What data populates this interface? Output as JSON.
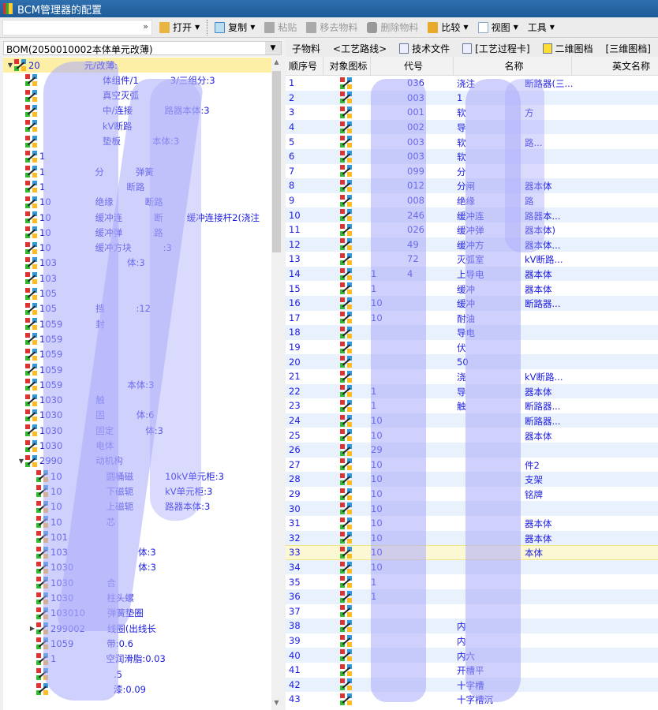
{
  "window": {
    "title": "BCM管理器的配置"
  },
  "toolbar": {
    "quick_dropdown": "»",
    "open": "打开",
    "copy": "复制",
    "paste": "粘贴",
    "move": "移去物料",
    "delete": "删除物料",
    "compare": "比较",
    "view": "视图",
    "tools": "工具"
  },
  "left": {
    "bom_select": "BOM(2050010002本体单元改薄)",
    "tree": [
      {
        "lvl": 0,
        "tw": "▼",
        "code": "20",
        "name": "元/改薄:"
      },
      {
        "lvl": 1,
        "code": "",
        "name": "体组件/1",
        "tail": "3/三组分:3"
      },
      {
        "lvl": 1,
        "code": "",
        "name": "真空灭弧"
      },
      {
        "lvl": 1,
        "code": "",
        "name": "中/连接",
        "tail": "路器本体:3"
      },
      {
        "lvl": 1,
        "code": "",
        "name": "kV断路"
      },
      {
        "lvl": 1,
        "code": "",
        "name": "垫板",
        "tail": "本体:3"
      },
      {
        "lvl": 1,
        "code": "1",
        "name": ""
      },
      {
        "lvl": 1,
        "code": "1",
        "name": "分",
        "tail": "弹簧"
      },
      {
        "lvl": 1,
        "code": "1",
        "name": "",
        "tail": "断路"
      },
      {
        "lvl": 1,
        "code": "10",
        "name": "绝缘",
        "tail": "断路"
      },
      {
        "lvl": 1,
        "code": "10",
        "name": "缓冲连",
        "tail": "断",
        "tail2": "缓冲连接杆2(浇注"
      },
      {
        "lvl": 1,
        "code": "10",
        "name": "缓冲弹",
        "tail": "路"
      },
      {
        "lvl": 1,
        "code": "10",
        "name": "缓冲方块",
        "tail": ":3"
      },
      {
        "lvl": 1,
        "code": "103",
        "name": "",
        "tail": "体:3"
      },
      {
        "lvl": 1,
        "code": "103",
        "name": ""
      },
      {
        "lvl": 1,
        "code": "105",
        "name": ""
      },
      {
        "lvl": 1,
        "code": "105",
        "name": "挡",
        "tail": ":12"
      },
      {
        "lvl": 1,
        "code": "1059",
        "name": "封"
      },
      {
        "lvl": 1,
        "code": "1059",
        "name": ""
      },
      {
        "lvl": 1,
        "code": "1059",
        "name": ""
      },
      {
        "lvl": 1,
        "code": "1059",
        "name": ""
      },
      {
        "lvl": 1,
        "code": "1059",
        "name": "",
        "tail": "本体:3"
      },
      {
        "lvl": 1,
        "code": "1030",
        "name": "触"
      },
      {
        "lvl": 1,
        "code": "1030",
        "name": "固",
        "tail": "体:6"
      },
      {
        "lvl": 1,
        "code": "1030",
        "name": "固定",
        "tail": "体:3"
      },
      {
        "lvl": 1,
        "code": "1030",
        "name": "电体"
      },
      {
        "lvl": 1,
        "tw": "▼",
        "code": "2990",
        "name": "动机构"
      },
      {
        "lvl": 2,
        "code": "10",
        "name": "圆桶磁",
        "tail": "10kV单元柜:3"
      },
      {
        "lvl": 2,
        "code": "10",
        "name": "下磁轭",
        "tail": "kV单元柜:3"
      },
      {
        "lvl": 2,
        "code": "10",
        "name": "上磁轭",
        "tail": "路器本体:3"
      },
      {
        "lvl": 2,
        "code": "10",
        "name": "芯"
      },
      {
        "lvl": 2,
        "code": "101",
        "name": ""
      },
      {
        "lvl": 2,
        "code": "103",
        "name": "",
        "tail": "体:3"
      },
      {
        "lvl": 2,
        "code": "1030",
        "name": "",
        "tail": "体:3"
      },
      {
        "lvl": 2,
        "code": "1030",
        "name": "合"
      },
      {
        "lvl": 2,
        "code": "1030",
        "name": "柱头螺"
      },
      {
        "lvl": 2,
        "code": "103010",
        "name": "弹簧垫圈"
      },
      {
        "lvl": 2,
        "tw": "▶",
        "code": "299002",
        "name": "线圈(出线长"
      },
      {
        "lvl": 2,
        "code": "1059",
        "name": "带:0.6"
      },
      {
        "lvl": 2,
        "code": "1",
        "name": "空润滑脂:0.03"
      },
      {
        "lvl": 2,
        "code": "",
        "name": ".5"
      },
      {
        "lvl": 2,
        "code": "",
        "name": "漆:0.09"
      }
    ]
  },
  "right": {
    "tabs": [
      {
        "label": "子物料",
        "icon": ""
      },
      {
        "label": "<工艺路线>",
        "icon": ""
      },
      {
        "label": "技术文件",
        "icon": "document-icon"
      },
      {
        "label": "[工艺过程卡]",
        "icon": "process-card-icon"
      },
      {
        "label": "二维图档",
        "icon": "drawing-2d-icon"
      },
      {
        "label": "[三维图档]",
        "icon": ""
      }
    ],
    "columns": [
      "顺序号",
      "对象图标",
      "代号",
      "名称",
      "英文名称"
    ],
    "selected_row": 33,
    "rows": [
      {
        "seq": "1",
        "code": "",
        "code2": "036",
        "name": "浇注",
        "name2": "断路器(三..."
      },
      {
        "seq": "2",
        "code": "",
        "code2": "003",
        "name": "1",
        "name2": ""
      },
      {
        "seq": "3",
        "code": "",
        "code2": "001",
        "name": "软",
        "name2": "方"
      },
      {
        "seq": "4",
        "code": "",
        "code2": "002",
        "name": "导",
        "name2": ""
      },
      {
        "seq": "5",
        "code": "",
        "code2": "003",
        "name": "软",
        "name2": "路..."
      },
      {
        "seq": "6",
        "code": "",
        "code2": "003",
        "name": "软",
        "name2": ""
      },
      {
        "seq": "7",
        "code": "",
        "code2": "099",
        "name": "分",
        "name2": ""
      },
      {
        "seq": "8",
        "code": "",
        "code2": "012",
        "name": "分闸",
        "name2": "器本体"
      },
      {
        "seq": "9",
        "code": "",
        "code2": "008",
        "name": "绝缘",
        "name2": "路"
      },
      {
        "seq": "10",
        "code": "",
        "code2": "246",
        "name": "缓冲连",
        "name2": "路器本..."
      },
      {
        "seq": "11",
        "code": "",
        "code2": "026",
        "name": "缓冲弹",
        "name2": "器本体)"
      },
      {
        "seq": "12",
        "code": "",
        "code2": "49",
        "name": "缓冲方",
        "name2": "器本体..."
      },
      {
        "seq": "13",
        "code": "",
        "code2": "72",
        "name": "灭弧室",
        "name2": "kV断路..."
      },
      {
        "seq": "14",
        "code": "1",
        "code2": "4",
        "name": "上导电",
        "name2": "器本体"
      },
      {
        "seq": "15",
        "code": "1",
        "code2": "",
        "name": "缓冲",
        "name2": "器本体"
      },
      {
        "seq": "16",
        "code": "10",
        "code2": "",
        "name": "缓冲",
        "name2": "断路器..."
      },
      {
        "seq": "17",
        "code": "10",
        "code2": "",
        "name": "耐油",
        "name2": ""
      },
      {
        "seq": "18",
        "code": "",
        "code2": "",
        "name": "导电",
        "name2": ""
      },
      {
        "seq": "19",
        "code": "",
        "code2": "",
        "name": "伏",
        "name2": ""
      },
      {
        "seq": "20",
        "code": "",
        "code2": "",
        "name": "50",
        "name2": ""
      },
      {
        "seq": "21",
        "code": "",
        "code2": "",
        "name": "浇",
        "name2": "kV断路..."
      },
      {
        "seq": "22",
        "code": "1",
        "code2": "",
        "name": "导",
        "name2": "器本体"
      },
      {
        "seq": "23",
        "code": "1",
        "code2": "",
        "name": "触",
        "name2": "断路器..."
      },
      {
        "seq": "24",
        "code": "10",
        "code2": "",
        "name": "",
        "name2": "断路器..."
      },
      {
        "seq": "25",
        "code": "10",
        "code2": "",
        "name": "",
        "name2": "器本体"
      },
      {
        "seq": "26",
        "code": "29",
        "code2": "",
        "name": "",
        "name2": ""
      },
      {
        "seq": "27",
        "code": "10",
        "code2": "",
        "name": "",
        "name2": "件2"
      },
      {
        "seq": "28",
        "code": "10",
        "code2": "",
        "name": "",
        "name2": "支架"
      },
      {
        "seq": "29",
        "code": "10",
        "code2": "",
        "name": "",
        "name2": "铭牌"
      },
      {
        "seq": "30",
        "code": "10",
        "code2": "",
        "name": "",
        "name2": ""
      },
      {
        "seq": "31",
        "code": "10",
        "code2": "",
        "name": "",
        "name2": "器本体"
      },
      {
        "seq": "32",
        "code": "10",
        "code2": "",
        "name": "",
        "name2": "器本体"
      },
      {
        "seq": "33",
        "code": "10",
        "code2": "",
        "name": "",
        "name2": "本体"
      },
      {
        "seq": "34",
        "code": "10",
        "code2": "",
        "name": "",
        "name2": ""
      },
      {
        "seq": "35",
        "code": "1",
        "code2": "",
        "name": "",
        "name2": ""
      },
      {
        "seq": "36",
        "code": "1",
        "code2": "",
        "name": "",
        "name2": ""
      },
      {
        "seq": "37",
        "code": "",
        "code2": "",
        "name": "",
        "name2": ""
      },
      {
        "seq": "38",
        "code": "",
        "code2": "",
        "name": "内",
        "name2": ""
      },
      {
        "seq": "39",
        "code": "",
        "code2": "",
        "name": "内",
        "name2": ""
      },
      {
        "seq": "40",
        "code": "",
        "code2": "",
        "name": "内六",
        "name2": ""
      },
      {
        "seq": "41",
        "code": "",
        "code2": "",
        "name": "开槽平",
        "name2": ""
      },
      {
        "seq": "42",
        "code": "",
        "code2": "",
        "name": "十字槽",
        "name2": ""
      },
      {
        "seq": "43",
        "code": "",
        "code2": "",
        "name": "十字槽沉",
        "name2": ""
      }
    ]
  }
}
